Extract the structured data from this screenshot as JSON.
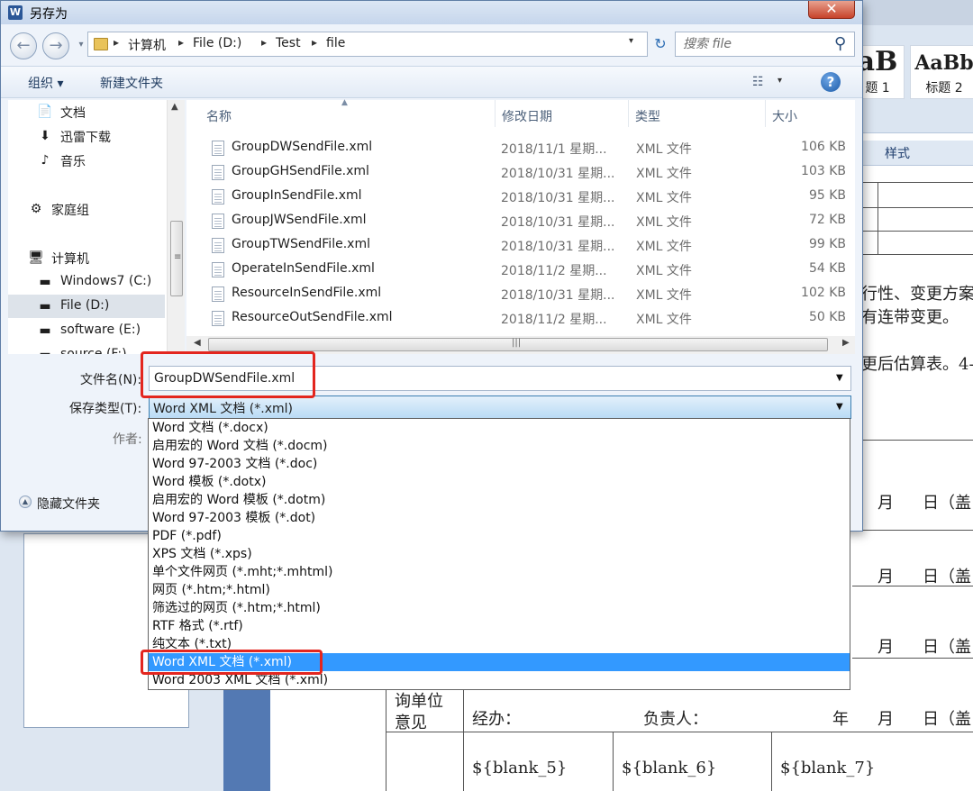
{
  "background": {
    "style_samples": [
      {
        "sample": "aB",
        "name": "题 1"
      },
      {
        "sample": "AaBb",
        "name": "标题 2"
      }
    ],
    "style_group_label": "样式",
    "doc_lines": [
      "行性、变更方案",
      "有连带变更。",
      "更后估算表。4-"
    ],
    "date_rows": [
      {
        "month": "月",
        "day": "日（盖"
      },
      {
        "month": "月",
        "day": "日（盖"
      },
      {
        "month": "月",
        "day": "日（盖"
      }
    ],
    "sign_row": {
      "unit_line1": "询单位",
      "unit_line2": "意见",
      "handler": "经办：",
      "responsible": "负责人：",
      "year": "年",
      "month": "月",
      "day": "日（盖"
    },
    "blanks": [
      "${blank_5}",
      "${blank_6}",
      "${blank_7}"
    ]
  },
  "dialog": {
    "title": "另存为",
    "close_glyph": "✕",
    "breadcrumb": [
      "计算机",
      "File (D:)",
      "Test",
      "file"
    ],
    "search_placeholder": "搜索 file",
    "toolbar": {
      "organize": "组织 ▾",
      "new_folder": "新建文件夹"
    },
    "nav_items": [
      {
        "icon": "📄",
        "label": "文档",
        "indent": 1
      },
      {
        "icon": "⬇",
        "label": "迅雷下载",
        "indent": 1
      },
      {
        "icon": "♪",
        "label": "音乐",
        "indent": 1
      },
      {
        "icon": "⚙",
        "label": "家庭组",
        "indent": 0
      },
      {
        "icon": "🖥",
        "label": "计算机",
        "indent": 0
      },
      {
        "icon": "▬",
        "label": "Windows7 (C:)",
        "indent": 1
      },
      {
        "icon": "▬",
        "label": "File (D:)",
        "indent": 1,
        "selected": true
      },
      {
        "icon": "▬",
        "label": "software (E:)",
        "indent": 1
      },
      {
        "icon": "▬",
        "label": "source (F:)",
        "indent": 1
      }
    ],
    "columns": {
      "name": "名称",
      "date": "修改日期",
      "type": "类型",
      "size": "大小"
    },
    "files": [
      {
        "name": "GroupDWSendFile.xml",
        "date": "2018/11/1 星期...",
        "type": "XML 文件",
        "size": "106 KB"
      },
      {
        "name": "GroupGHSendFile.xml",
        "date": "2018/10/31 星期...",
        "type": "XML 文件",
        "size": "103 KB"
      },
      {
        "name": "GroupInSendFile.xml",
        "date": "2018/10/31 星期...",
        "type": "XML 文件",
        "size": "95 KB"
      },
      {
        "name": "GroupJWSendFile.xml",
        "date": "2018/10/31 星期...",
        "type": "XML 文件",
        "size": "72 KB"
      },
      {
        "name": "GroupTWSendFile.xml",
        "date": "2018/10/31 星期...",
        "type": "XML 文件",
        "size": "99 KB"
      },
      {
        "name": "OperateInSendFile.xml",
        "date": "2018/11/2 星期...",
        "type": "XML 文件",
        "size": "54 KB"
      },
      {
        "name": "ResourceInSendFile.xml",
        "date": "2018/10/31 星期...",
        "type": "XML 文件",
        "size": "102 KB"
      },
      {
        "name": "ResourceOutSendFile.xml",
        "date": "2018/11/2 星期...",
        "type": "XML 文件",
        "size": "50 KB"
      }
    ],
    "filename_label": "文件名(N):",
    "filename_value": "GroupDWSendFile.xml",
    "savetype_label": "保存类型(T):",
    "savetype_value": "Word XML 文档 (*.xml)",
    "author_label": "作者:",
    "hide_folders_label": "隐藏文件夹",
    "type_options": [
      "Word 文档 (*.docx)",
      "启用宏的 Word 文档 (*.docm)",
      "Word 97-2003 文档 (*.doc)",
      "Word 模板 (*.dotx)",
      "启用宏的 Word 模板 (*.dotm)",
      "Word 97-2003 模板 (*.dot)",
      "PDF (*.pdf)",
      "XPS 文档 (*.xps)",
      "单个文件网页 (*.mht;*.mhtml)",
      "网页 (*.htm;*.html)",
      "筛选过的网页 (*.htm;*.html)",
      "RTF 格式 (*.rtf)",
      "纯文本 (*.txt)",
      "Word XML 文档 (*.xml)",
      "Word 2003 XML 文档 (*.xml)"
    ],
    "selected_type_index": 13
  }
}
